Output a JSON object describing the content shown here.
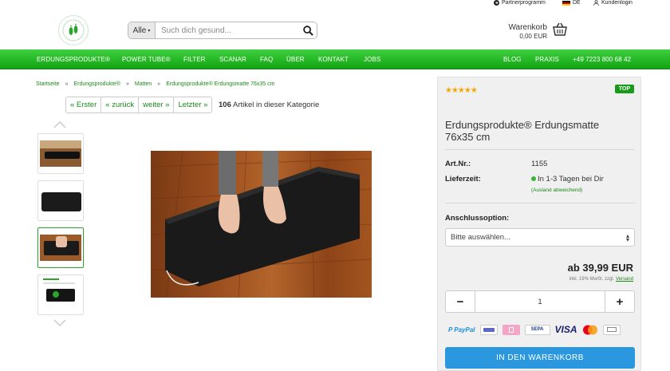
{
  "topbar": {
    "partner": "Partnerprogramm",
    "language": "DE",
    "login": "Kundenlogin"
  },
  "search": {
    "category": "Alle",
    "placeholder": "Such dich gesund..."
  },
  "cart": {
    "label": "Warenkorb",
    "amount": "0,00 EUR"
  },
  "nav": {
    "left": [
      "ERDUNGSPRODUKTE®",
      "POWER TUBE®",
      "FILTER",
      "SCANAR",
      "FAQ",
      "ÜBER",
      "KONTAKT",
      "JOBS"
    ],
    "right": [
      "BLOG",
      "PRAXIS",
      "+49 7223 800 68 42"
    ]
  },
  "breadcrumb": [
    "Startseite",
    "Erdungsprodukte®",
    "Matten",
    "Erdungsprodukte® Erdungsmatte 76x35 cm"
  ],
  "breadcrumb_sep": "»",
  "pager": {
    "first": "« Erster",
    "prev": "« zurück",
    "next": "weiter »",
    "last": "Letzter »",
    "count": "106",
    "count_label": "Artikel in dieser Kategorie"
  },
  "product": {
    "rating_stars": "★★★★★",
    "badge": "TOP",
    "title": "Erdungsprodukte® Erdungsmatte 76x35 cm",
    "art_label": "Art.Nr.:",
    "art_value": "1155",
    "delivery_label": "Lieferzeit:",
    "delivery_value": "In 1-3 Tagen bei Dir",
    "delivery_note": "(Ausland abweichend)",
    "option_label": "Anschlussoption:",
    "option_value": "Bitte auswählen...",
    "price": "ab 39,99 EUR",
    "vat_text": "inkl. 19% MwSt. zzgl.",
    "shipping_link": "Versand",
    "quantity": "1",
    "minus": "−",
    "plus": "+",
    "paypal_a": "P PayPal",
    "visa": "VISA",
    "sepa": "SEPA",
    "add_to_cart": "IN DEN WARENKORB"
  },
  "colors": {
    "nav_green": "#13a313",
    "link_green": "#1a8a1a",
    "cta_blue": "#2a97df",
    "star": "#f5a800"
  }
}
